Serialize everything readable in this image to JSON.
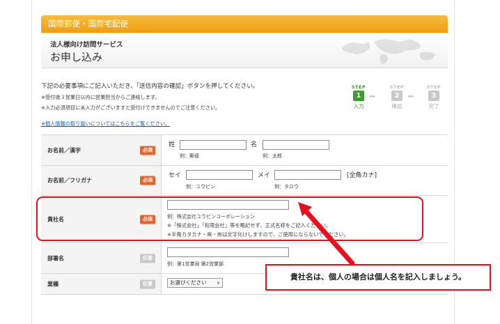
{
  "header": {
    "service_bar": "国際郵便・国際宅配便",
    "subtitle": "法人様向け訪問サービス",
    "title": "お申し込み"
  },
  "intro": {
    "line1": "下記の必要事項にご記入いただき、「送信内容の確認」ボタンを押してください。",
    "note1": "※受付後３営業日以内に営業担当からご連絡します。",
    "note2": "※入力必須項目に未入力がございますと受付けできませんのでご注意ください。",
    "privacy_link": "※個人情報の取り扱いについてはこちらをご覧ください。"
  },
  "steps": [
    {
      "label": "STEP",
      "number": "1",
      "name": "入力",
      "active": true
    },
    {
      "label": "STEP",
      "number": "2",
      "name": "確認",
      "active": false
    },
    {
      "label": "STEP",
      "number": "3",
      "name": "完了",
      "active": false
    }
  ],
  "step_arrow": "▸▸▸",
  "form": {
    "required_badge": "必須",
    "optional_badge": "任意",
    "name_kanji": {
      "label": "お名前／漢字",
      "sei_label": "姓",
      "mei_label": "名",
      "sei_value": "",
      "mei_value": "",
      "sei_example": "例：郵便",
      "mei_example": "例：太郎"
    },
    "name_furigana": {
      "label": "お名前／フリガナ",
      "sei_label": "セイ",
      "mei_label": "メイ",
      "sei_value": "",
      "mei_value": "",
      "sei_example": "例：ユウビン",
      "mei_example": "例：タロウ",
      "hint": "[全角カナ]"
    },
    "company": {
      "label": "貴社名",
      "value": "",
      "example": "例：株式会社ユウビンコーポレーション",
      "note1": "※「株式会社」「有限会社」等を略記せず、正式名称をご記入ください。",
      "note2": "※半角カタカナ・㈱・㈲は文字化けしますので、ご使用にならないでください。"
    },
    "department": {
      "label": "部署名",
      "value": "",
      "example": "例：第1営業局 第2営業部"
    },
    "industry": {
      "label": "業種",
      "selected": "お選びください"
    }
  },
  "callout": {
    "text": "貴社名は、個人の場合は個人名を記入しましょう。"
  },
  "colors": {
    "accent_orange": "#ef9e0f",
    "step_active": "#3f9a36",
    "required_badge": "#e8622a",
    "annotation_red": "#e8101e",
    "link_blue": "#0b5bbd"
  }
}
